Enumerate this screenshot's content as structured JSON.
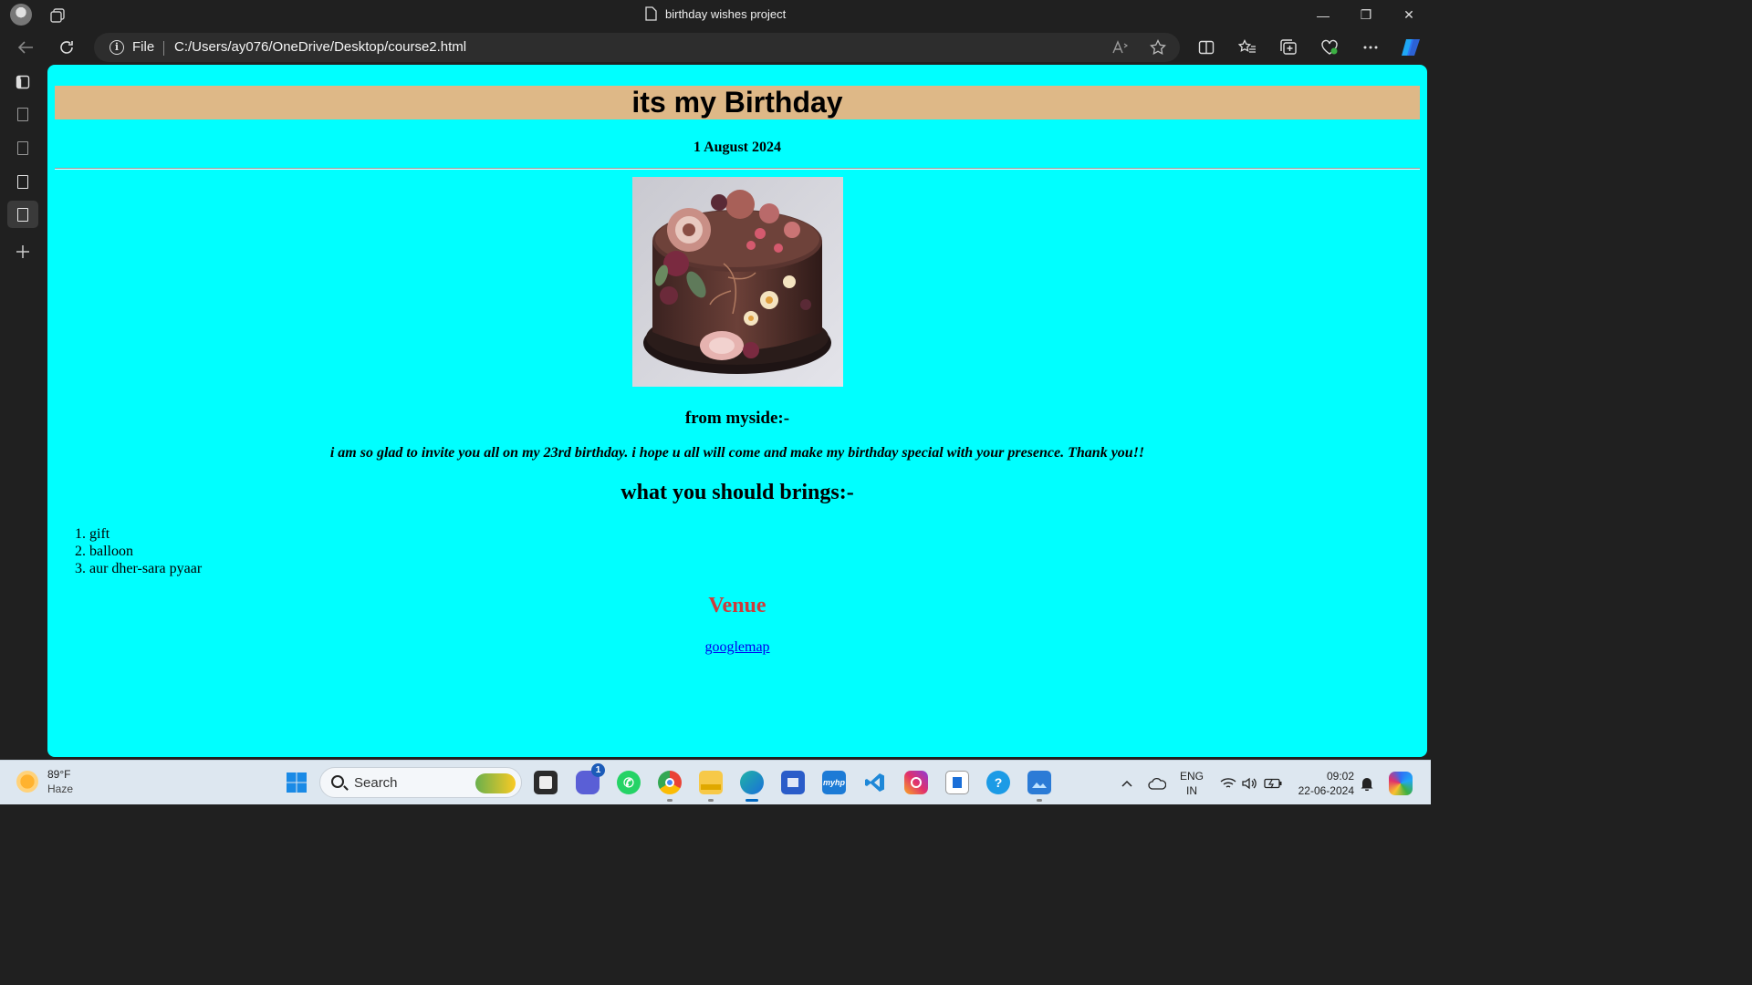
{
  "window": {
    "tab_title": "birthday wishes project",
    "minimize": "—",
    "restore": "❐",
    "close": "✕"
  },
  "toolbar": {
    "site_info_label": "File",
    "url": "C:/Users/ay076/OneDrive/Desktop/course2.html"
  },
  "page": {
    "heading": "its my Birthday",
    "date": "1 August 2024",
    "from_heading": "from myside:-",
    "invitation": "i am so glad to invite you all on my 23rd birthday. i hope u all will come and make my birthday special with your presence. Thank you!!",
    "bring_heading": "what you should brings:-",
    "bring_items": [
      "gift",
      "balloon",
      "aur dher-sara pyaar"
    ],
    "venue_heading": "Venue",
    "map_link": "googlemap",
    "colors": {
      "background": "#00ffff",
      "heading_bar": "#deb887",
      "venue": "#cd3b3b",
      "link": "#0000ee"
    }
  },
  "taskbar": {
    "temperature": "89°F",
    "condition": "Haze",
    "search_placeholder": "Search",
    "teams_badge": "1",
    "lang_line1": "ENG",
    "lang_line2": "IN",
    "time": "09:02",
    "date": "22-06-2024"
  }
}
